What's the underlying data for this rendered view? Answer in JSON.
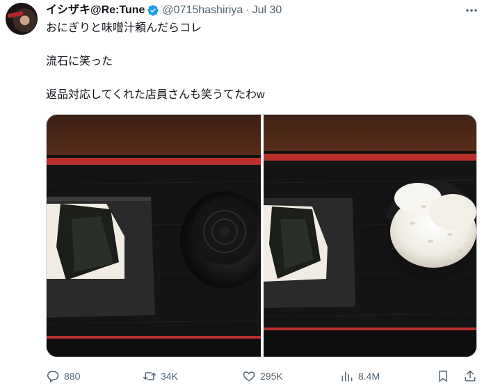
{
  "tweet": {
    "display_name": "イシザキ@Re:Tune",
    "handle": "@0715hashiriya",
    "separator": "·",
    "date": "Jul 30",
    "lines": [
      "おにぎりと味噌汁頼んだらコレ",
      "流石に笑った",
      "返品対応してくれた店員さんも笑うてたわw"
    ],
    "verified_color": "#1d9bf0"
  },
  "actions": {
    "replies": "880",
    "retweets": "34K",
    "likes": "295K",
    "views": "8.4M"
  },
  "icons": {
    "more": "more-icon",
    "reply": "reply-icon",
    "retweet": "retweet-icon",
    "like": "heart-icon",
    "views": "views-icon",
    "bookmark": "bookmark-icon",
    "share": "share-icon"
  }
}
